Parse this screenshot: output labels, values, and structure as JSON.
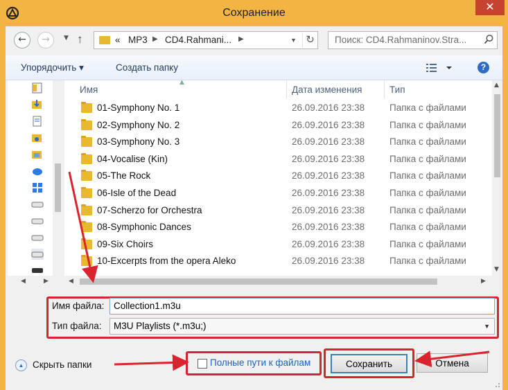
{
  "window": {
    "title": "Сохранение",
    "close_label": "✕"
  },
  "address": {
    "prefix": "«",
    "segments": [
      "MP3",
      "CD4.Rahmani..."
    ]
  },
  "search": {
    "placeholder": "Поиск: CD4.Rahmaninov.Stra..."
  },
  "toolbar": {
    "organize_label": "Упорядочить ▾",
    "new_folder_label": "Создать папку"
  },
  "columns": {
    "name": "Имя",
    "date": "Дата изменения",
    "type": "Тип"
  },
  "files": [
    {
      "name": "01-Symphony No. 1",
      "date": "26.09.2016 23:38",
      "type": "Папка с файлами"
    },
    {
      "name": "02-Symphony No. 2",
      "date": "26.09.2016 23:38",
      "type": "Папка с файлами"
    },
    {
      "name": "03-Symphony No. 3",
      "date": "26.09.2016 23:38",
      "type": "Папка с файлами"
    },
    {
      "name": "04-Vocalise (Kin)",
      "date": "26.09.2016 23:38",
      "type": "Папка с файлами"
    },
    {
      "name": "05-The Rock",
      "date": "26.09.2016 23:38",
      "type": "Папка с файлами"
    },
    {
      "name": "06-Isle of the Dead",
      "date": "26.09.2016 23:38",
      "type": "Папка с файлами"
    },
    {
      "name": "07-Scherzo for Orchestra",
      "date": "26.09.2016 23:38",
      "type": "Папка с файлами"
    },
    {
      "name": "08-Symphonic Dances",
      "date": "26.09.2016 23:38",
      "type": "Папка с файлами"
    },
    {
      "name": "09-Six Choirs",
      "date": "26.09.2016 23:38",
      "type": "Папка с файлами"
    },
    {
      "name": "10-Excerpts from the opera Aleko",
      "date": "26.09.2016 23:38",
      "type": "Папка с файлами"
    }
  ],
  "filename": {
    "label": "Имя файла:",
    "value": "Collection1.m3u"
  },
  "filetype": {
    "label": "Тип файла:",
    "value": "M3U Playlists (*.m3u;)"
  },
  "hide_folders_label": "Скрыть папки",
  "full_paths": {
    "label": "Полные пути к файлам",
    "checked": false
  },
  "buttons": {
    "save": "Сохранить",
    "cancel": "Отмена"
  },
  "colors": {
    "titlebar": "#f2b544",
    "close": "#c8432f",
    "highlight": "#d8242c",
    "link": "#1b63bd"
  },
  "icons": [
    "app-icon",
    "back-icon",
    "forward-icon",
    "up-icon",
    "folder-icon",
    "refresh-icon",
    "search-icon",
    "view-icon",
    "help-icon",
    "chevron-up-icon"
  ]
}
